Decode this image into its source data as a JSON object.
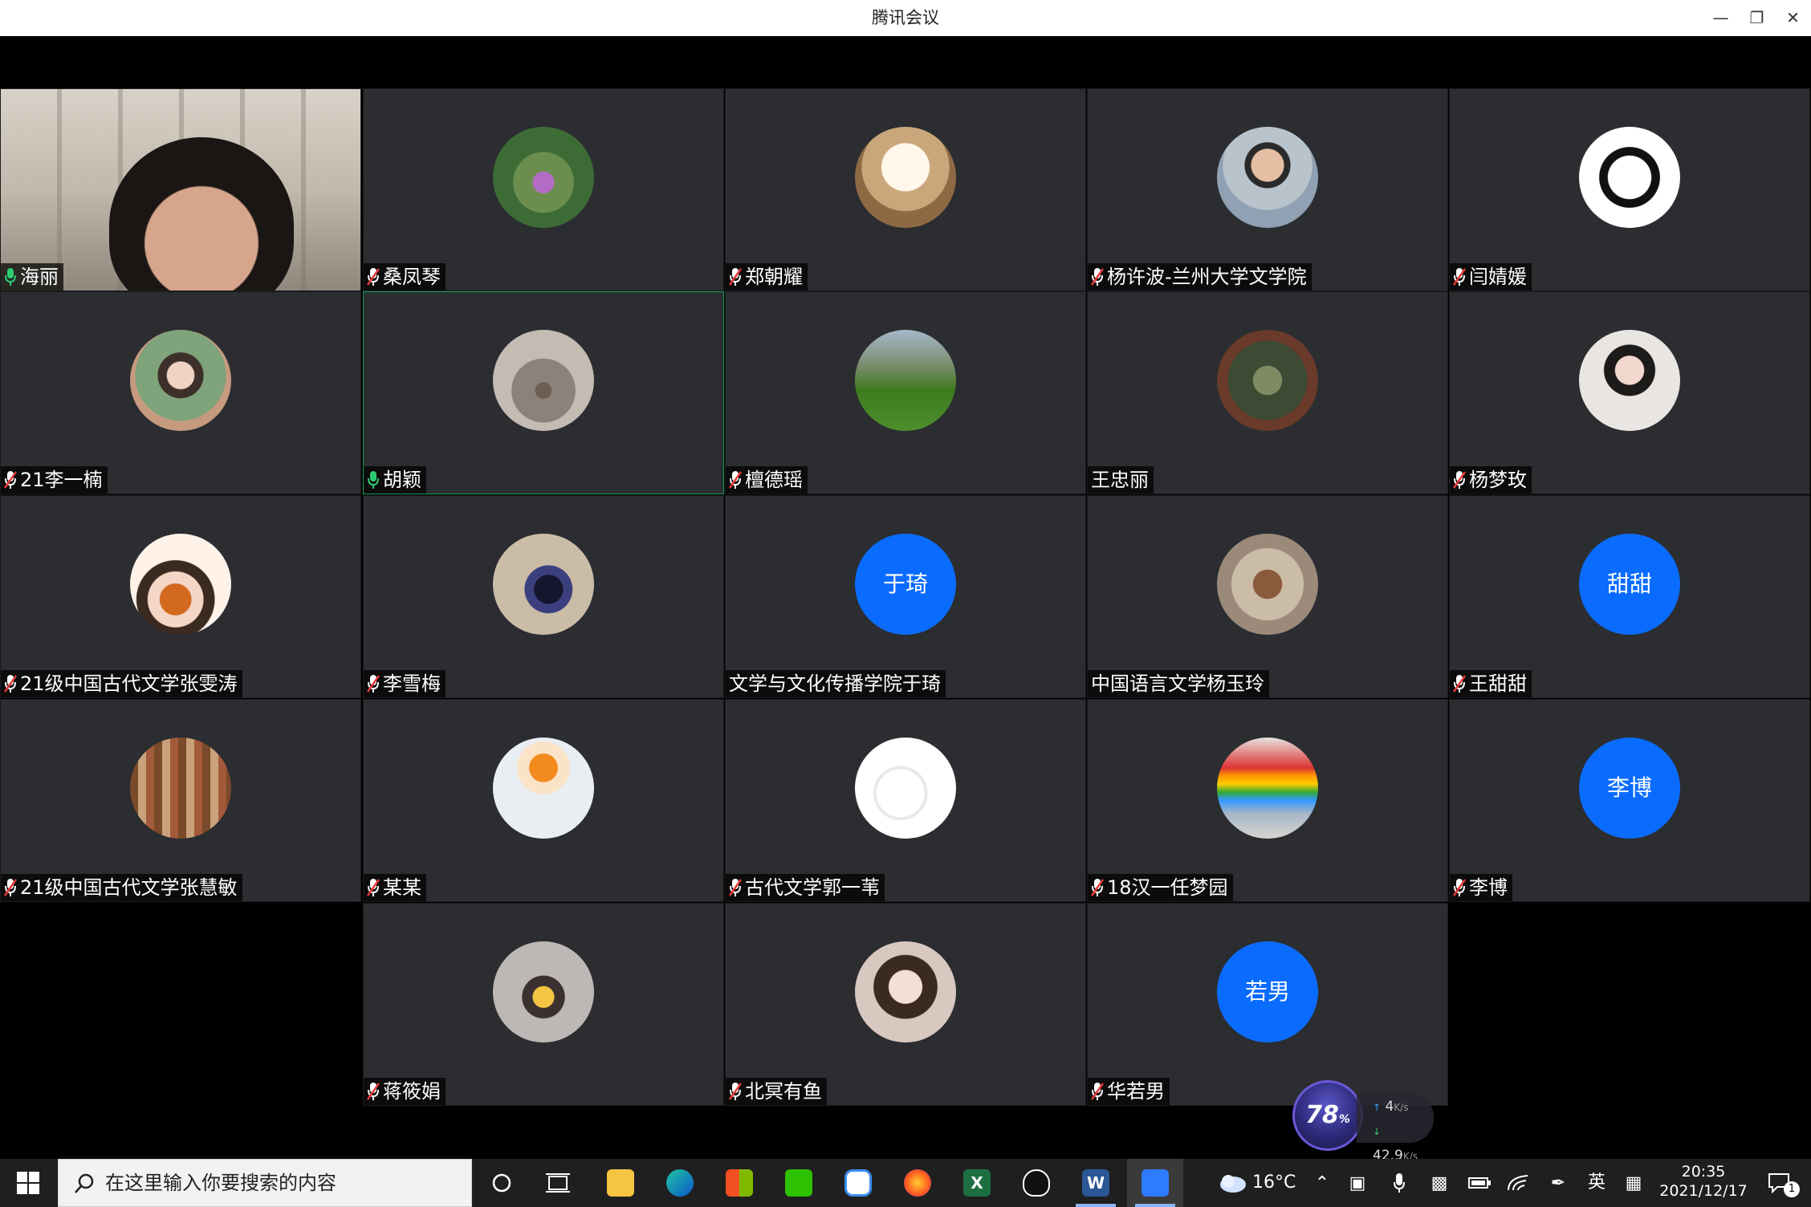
{
  "window": {
    "title": "腾讯会议",
    "minimize_icon": "minimize-icon",
    "restore_icon": "restore-icon",
    "close_icon": "close-icon"
  },
  "participants": [
    {
      "name": "海丽",
      "camera": true,
      "mic": "on"
    },
    {
      "name": "桑凤琴",
      "mic": "muted",
      "avatar": "flowers"
    },
    {
      "name": "郑朝耀",
      "mic": "muted",
      "avatar": "rabbit-cartoon"
    },
    {
      "name": "杨许波-兰州大学文学院",
      "mic": "muted",
      "avatar": "man-photo"
    },
    {
      "name": "闫婧媛",
      "mic": "muted",
      "avatar": "girl-drawing"
    },
    {
      "name": "21李一楠",
      "mic": "muted",
      "avatar": "girl-photo"
    },
    {
      "name": "胡颖",
      "mic": "on",
      "avatar": "tree",
      "active": true
    },
    {
      "name": "檀德瑶",
      "mic": "muted",
      "avatar": "landscape"
    },
    {
      "name": "王忠丽",
      "mic": "none",
      "avatar": "flowers-dark"
    },
    {
      "name": "杨梦玫",
      "mic": "muted",
      "avatar": "woman-photo"
    },
    {
      "name": "21级中国古代文学张雯涛",
      "mic": "muted",
      "avatar": "girl-dog-cartoon"
    },
    {
      "name": "李雪梅",
      "mic": "muted",
      "avatar": "person-photo"
    },
    {
      "name": "文学与文化传播学院于琦",
      "mic": "none",
      "avatar_text": "于琦"
    },
    {
      "name": "中国语言文学杨玉玲",
      "mic": "none",
      "avatar": "dragon-art"
    },
    {
      "name": "王甜甜",
      "mic": "muted",
      "avatar_text": "甜甜"
    },
    {
      "name": "21级中国古代文学张慧敏",
      "mic": "muted",
      "avatar": "library-cartoon"
    },
    {
      "name": "某某",
      "mic": "muted",
      "avatar": "boy-cartoon"
    },
    {
      "name": "古代文学郭一苇",
      "mic": "muted",
      "avatar": "sketch-face"
    },
    {
      "name": "18汉一任梦园",
      "mic": "muted",
      "avatar": "rainbow-photo"
    },
    {
      "name": "李博",
      "mic": "muted",
      "avatar_text": "李博"
    },
    {
      "name": "蒋筱娟",
      "mic": "muted",
      "avatar": "kid-photo"
    },
    {
      "name": "北冥有鱼",
      "mic": "muted",
      "avatar": "girl-portrait"
    },
    {
      "name": "华若男",
      "mic": "muted",
      "avatar_text": "若男"
    }
  ],
  "network_widget": {
    "percent": "78",
    "percent_sign": "%",
    "upload": "4",
    "upload_unit": "K/s",
    "download": "42.9",
    "download_unit": "K/s"
  },
  "taskbar": {
    "search_placeholder": "在这里输入你要搜索的内容",
    "weather_temp": "16°C",
    "ime": "英",
    "time": "20:35",
    "date": "2021/12/17",
    "notification_count": "1"
  },
  "colors": {
    "tile_bg": "#2b2d31",
    "letter_avatar": "#0a6cff",
    "active_border": "#18a058",
    "mic_on": "#2ecc71",
    "mic_muted": "#e53935"
  }
}
